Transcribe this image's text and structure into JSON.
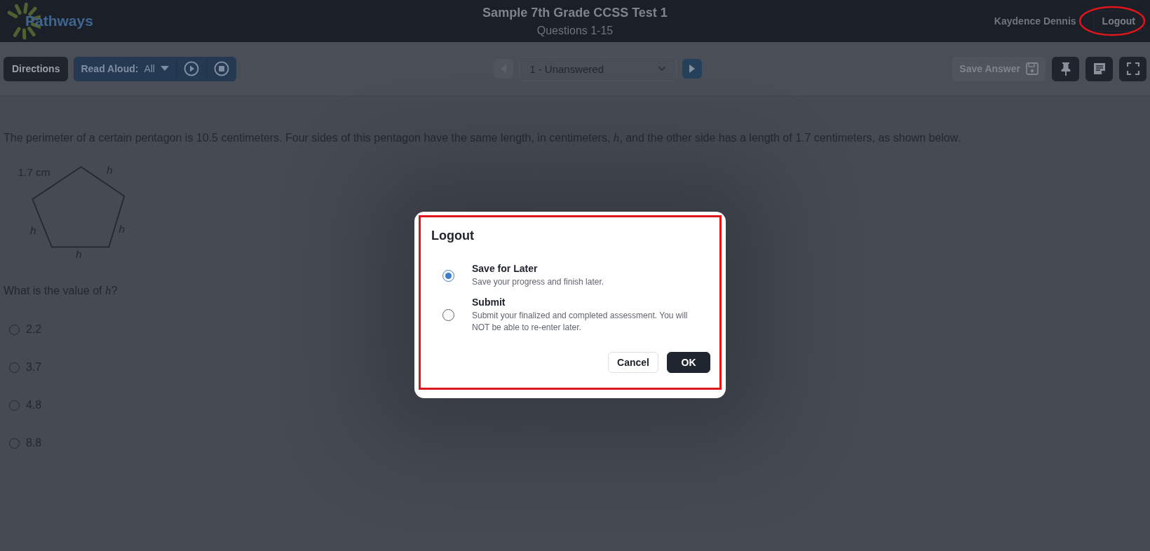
{
  "header": {
    "logo": "Pathways",
    "title": "Sample 7th Grade CCSS Test 1",
    "subtitle": "Questions 1-15",
    "user": "Kaydence Dennis",
    "logout": "Logout"
  },
  "toolbar": {
    "directions": "Directions",
    "read_aloud": {
      "label": "Read Aloud:",
      "value": "All"
    },
    "prev": {
      "disabled": true
    },
    "question_select": {
      "value": "1 - Unanswered"
    },
    "next": {
      "disabled": false
    },
    "save_answer": {
      "label": "Save Answer",
      "disabled": true
    }
  },
  "question": {
    "stem": "The perimeter of a certain pentagon is 10.5 centimeters. Four sides of this pentagon have the same length, in centimeters, *h*, and the other side has a length of 1.7 centimeters, as shown below.",
    "figure": {
      "labels": [
        "1.7 cm",
        "h",
        "h",
        "h",
        "h"
      ]
    },
    "prompt": "What is the value of *h*?",
    "options": [
      {
        "label": "2.2",
        "selected": false
      },
      {
        "label": "3.7",
        "selected": false
      },
      {
        "label": "4.8",
        "selected": false
      },
      {
        "label": "8.8",
        "selected": false
      }
    ]
  },
  "dialog": {
    "title": "Logout",
    "options": [
      {
        "title": "Save for Later",
        "description": "Save your progress and finish later.",
        "selected": true
      },
      {
        "title": "Submit",
        "description": "Submit your finalized and completed assessment. You will NOT be able to re-enter later.",
        "selected": false
      }
    ],
    "buttons": [
      {
        "label": "Cancel",
        "kind": "secondary"
      },
      {
        "label": "OK",
        "kind": "primary"
      }
    ]
  },
  "annotations": [
    {
      "kind": "ellipse"
    },
    {
      "kind": "frame"
    }
  ]
}
